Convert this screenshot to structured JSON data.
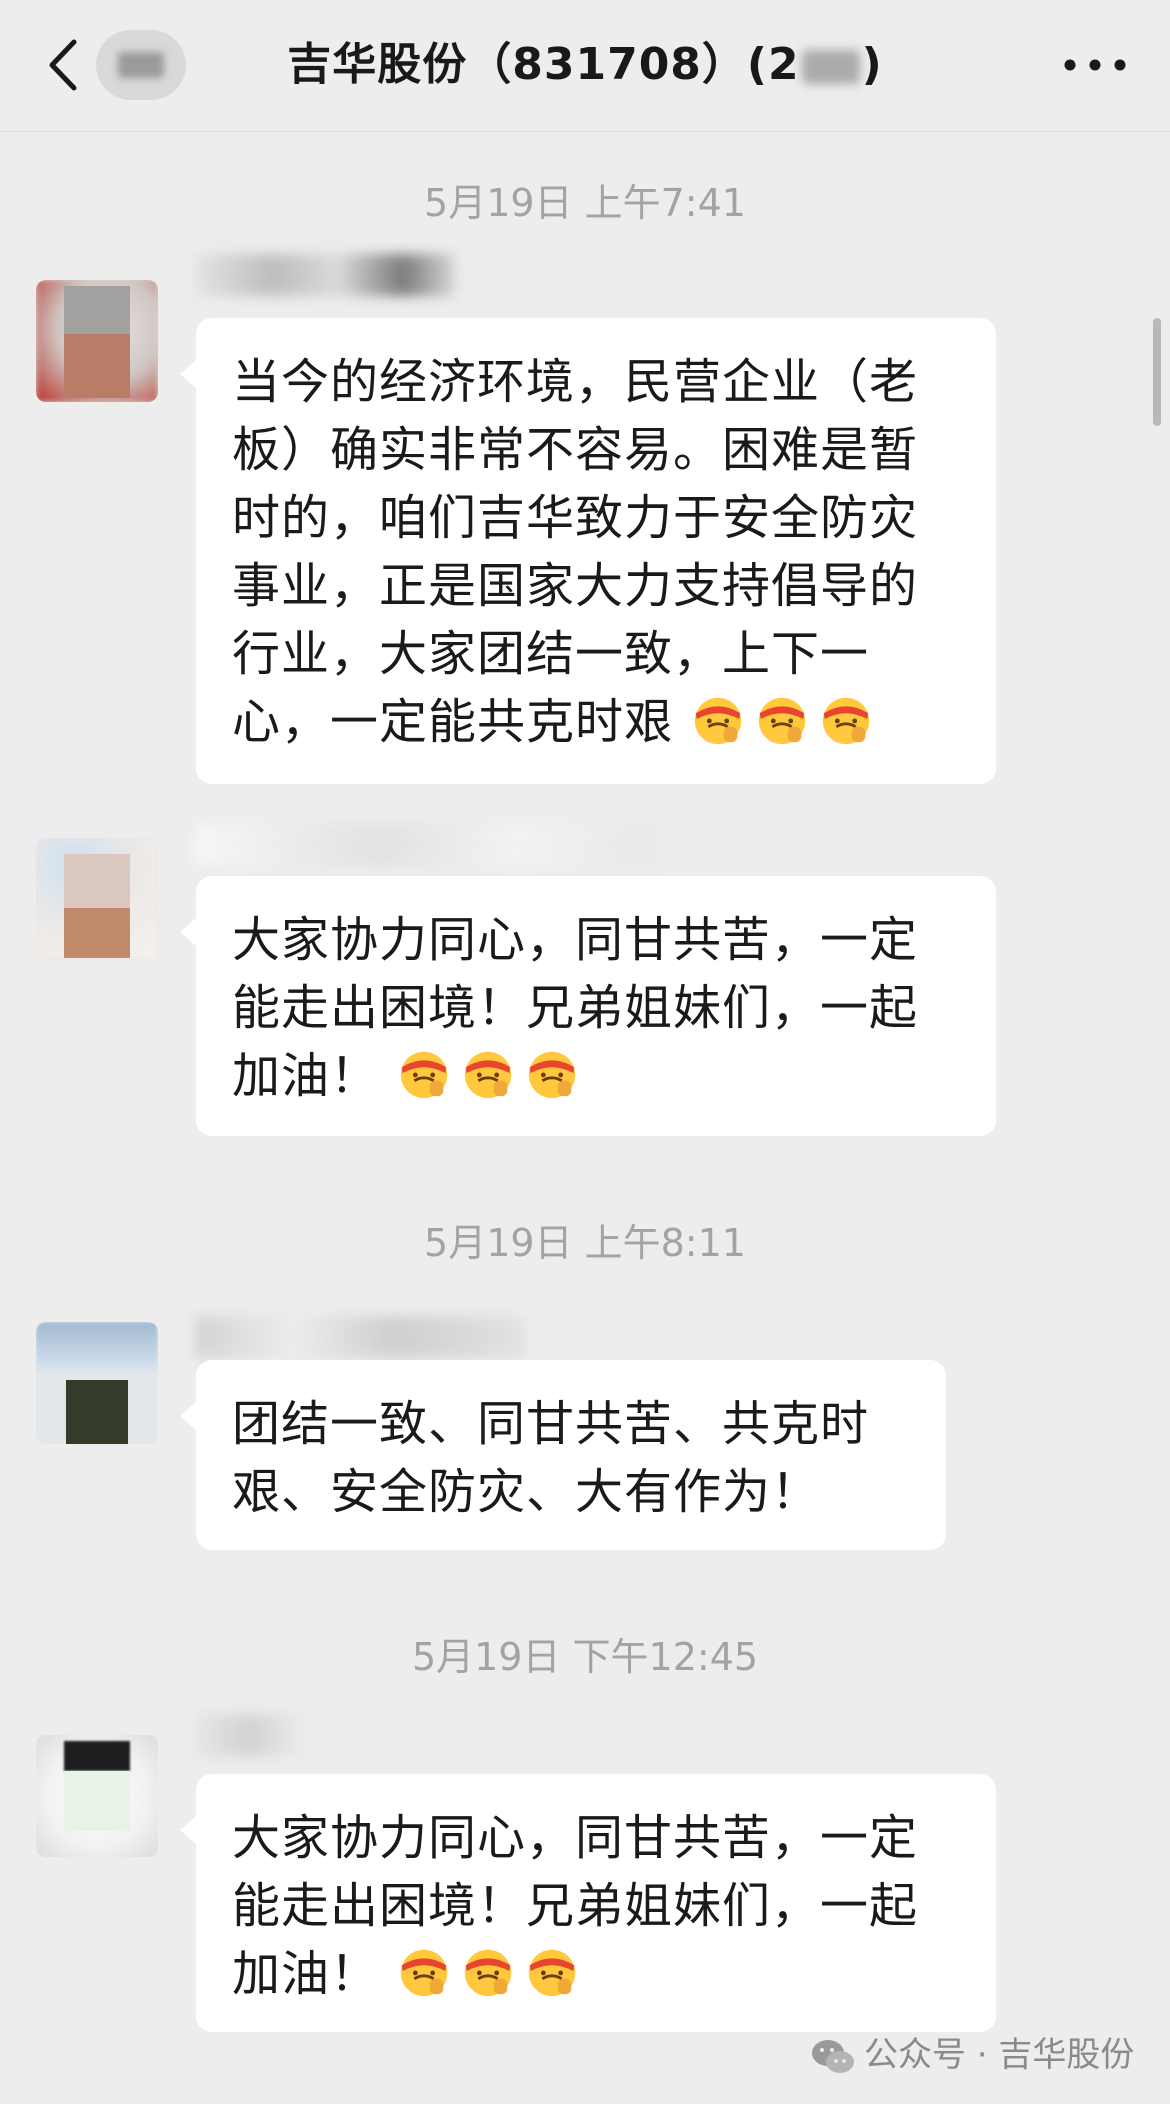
{
  "header": {
    "title_prefix": "吉华股份（831708）(2",
    "title_suffix": ")",
    "back_icon": "chevron-left-icon",
    "more_icon": "ellipsis-icon"
  },
  "timestamps": [
    "5月19日 上午7:41",
    "5月19日 上午8:11",
    "5月19日 下午12:45"
  ],
  "messages": [
    {
      "text": "当今的经济环境，民营企业（老板）确实非常不容易。困难是暂时的，咱们吉华致力于安全防灾事业，正是国家大力支持倡导的行业，大家团结一致，上下一心，一定能共克时艰",
      "emoji_count": 3,
      "emoji": "saluting-face-headband-icon"
    },
    {
      "text": "大家协力同心，同甘共苦，一定能走出困境！兄弟姐妹们，一起加油！",
      "emoji_count": 3,
      "emoji": "saluting-face-headband-icon"
    },
    {
      "text": "团结一致、同甘共苦、共克时艰、安全防灾、大有作为！",
      "emoji_count": 0
    },
    {
      "text": "大家协力同心，同甘共苦，一定能走出困境！兄弟姐妹们，一起加油！",
      "emoji_count": 3,
      "emoji": "saluting-face-headband-icon"
    }
  ],
  "watermark": {
    "icon": "wechat-icon",
    "text": "公众号 · 吉华股份"
  },
  "colors": {
    "background": "#ededed",
    "bubble": "#ffffff",
    "timestamp": "#a3a3a3"
  }
}
